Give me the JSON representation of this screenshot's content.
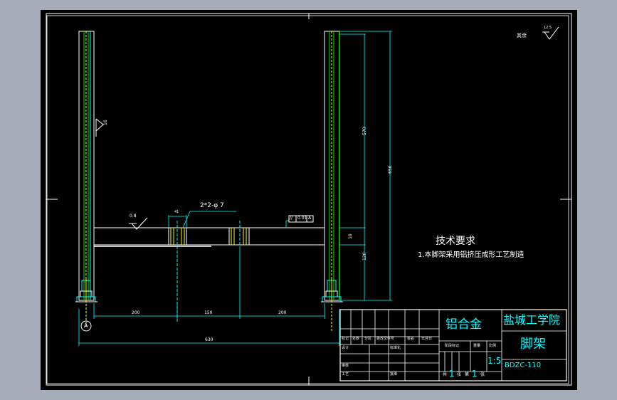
{
  "surface_finish": {
    "label": "其余",
    "value": "12.5"
  },
  "weld_symbol_value": "16",
  "roughness_left": "0.8",
  "hole_callout": "2*2-φ 7",
  "tolerance_frame": {
    "symbol": "//",
    "value": "0.01",
    "datum": "A"
  },
  "dims": {
    "top_hole": "41",
    "right_570": "570",
    "right_650": "650",
    "right_10": "10",
    "right_120": "120",
    "bottom_200a": "200",
    "bottom_150": "150",
    "bottom_200b": "200",
    "overall": "630"
  },
  "datum_label": "A",
  "tech_req": {
    "title": "技术要求",
    "item": "1.本脚架采用铝挤压成形工艺制造"
  },
  "title_block": {
    "material": "铝合金",
    "school": "盐城工学院",
    "part_name": "脚架",
    "drawing_no": "BDZC-110",
    "scale": "1:5",
    "revision_headers": [
      "标记",
      "处数",
      "分区",
      "更改文件号",
      "签名",
      "年月日"
    ],
    "role_design": "设计",
    "role_standard": "标准化",
    "role_review": "审核",
    "role_process": "工艺",
    "role_approve": "批准",
    "stage_mark": "阶段标记",
    "weight": "重量",
    "ratio": "比例",
    "sheet_total_prefix": "共",
    "sheet_total": "1",
    "sheet_total_suffix": "张",
    "sheet_no_prefix": "第",
    "sheet_no": "1",
    "sheet_no_suffix": "张"
  }
}
